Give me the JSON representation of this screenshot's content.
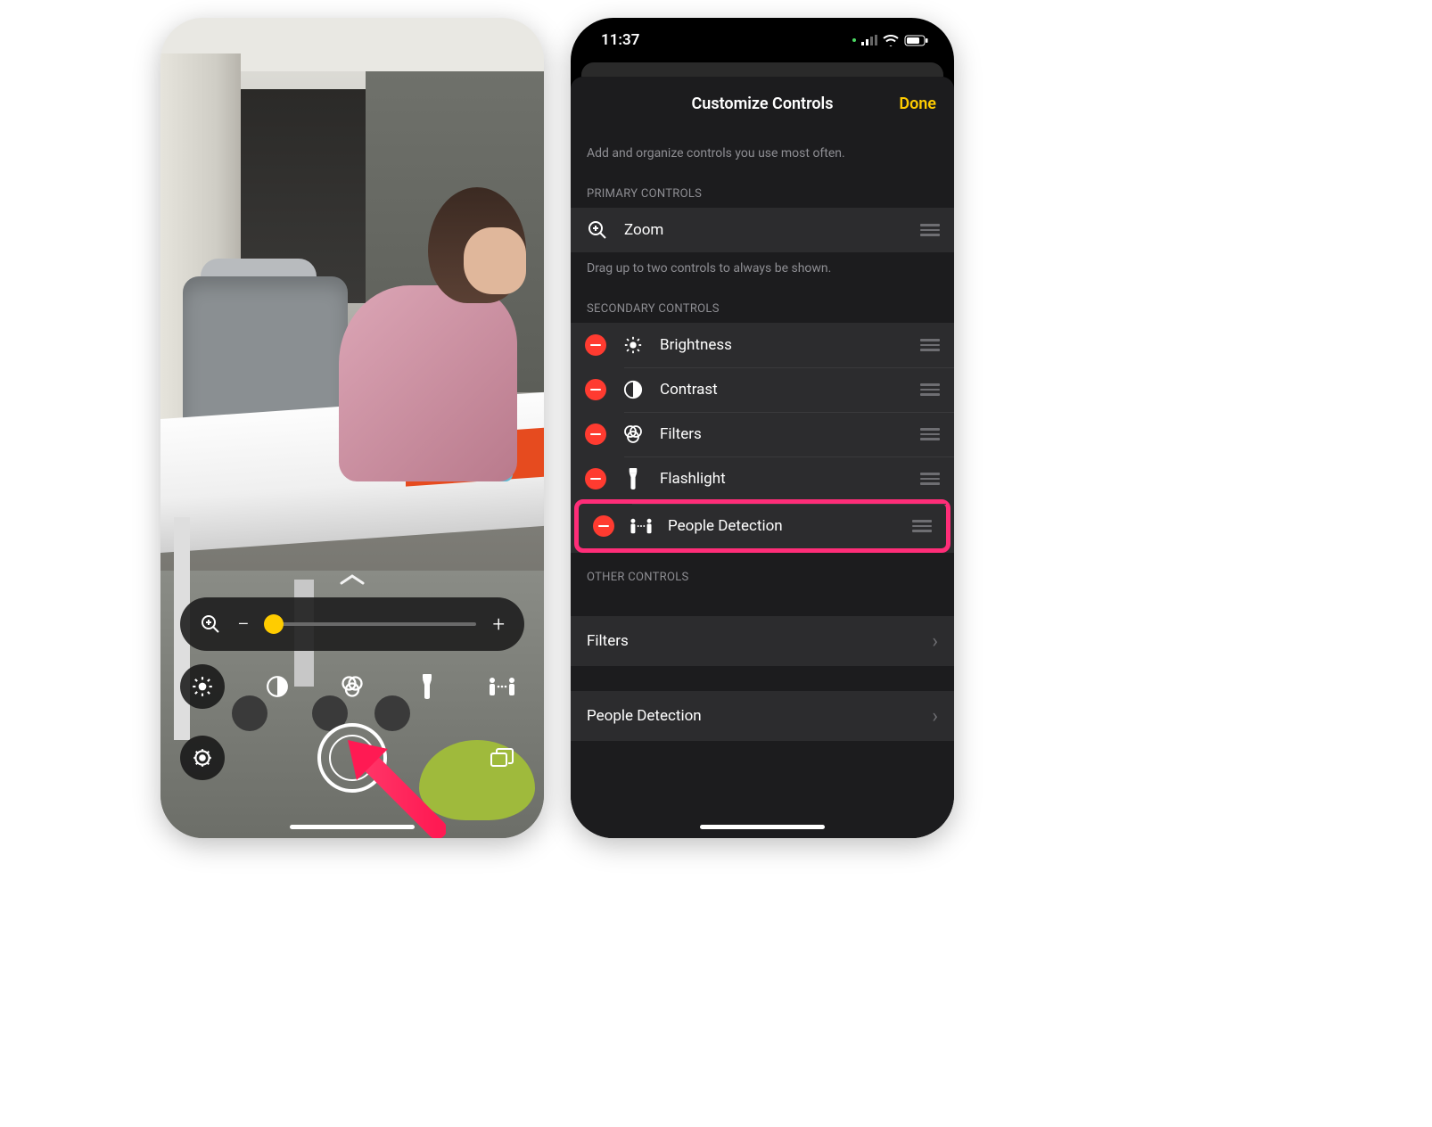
{
  "left": {
    "zoom_icon": "zoom-in",
    "minus": "−",
    "plus": "+",
    "icons": [
      "brightness",
      "contrast",
      "filters",
      "flashlight",
      "people-detection"
    ],
    "settings_icon": "gear",
    "multiwindow_icon": "multiwindow"
  },
  "right": {
    "status": {
      "time": "11:37"
    },
    "header": {
      "title": "Customize Controls",
      "done": "Done"
    },
    "note": "Add and organize controls you use most often.",
    "primary_head": "PRIMARY CONTROLS",
    "primary": [
      {
        "label": "Zoom",
        "icon": "zoom-in"
      }
    ],
    "primary_note": "Drag up to two controls to always be shown.",
    "secondary_head": "SECONDARY CONTROLS",
    "secondary": [
      {
        "label": "Brightness",
        "icon": "brightness"
      },
      {
        "label": "Contrast",
        "icon": "contrast"
      },
      {
        "label": "Filters",
        "icon": "filters"
      },
      {
        "label": "Flashlight",
        "icon": "flashlight"
      },
      {
        "label": "People Detection",
        "icon": "people-detection",
        "highlight": true
      }
    ],
    "other_head": "OTHER CONTROLS",
    "other": [
      {
        "label": "Filters"
      },
      {
        "label": "People Detection"
      }
    ]
  }
}
